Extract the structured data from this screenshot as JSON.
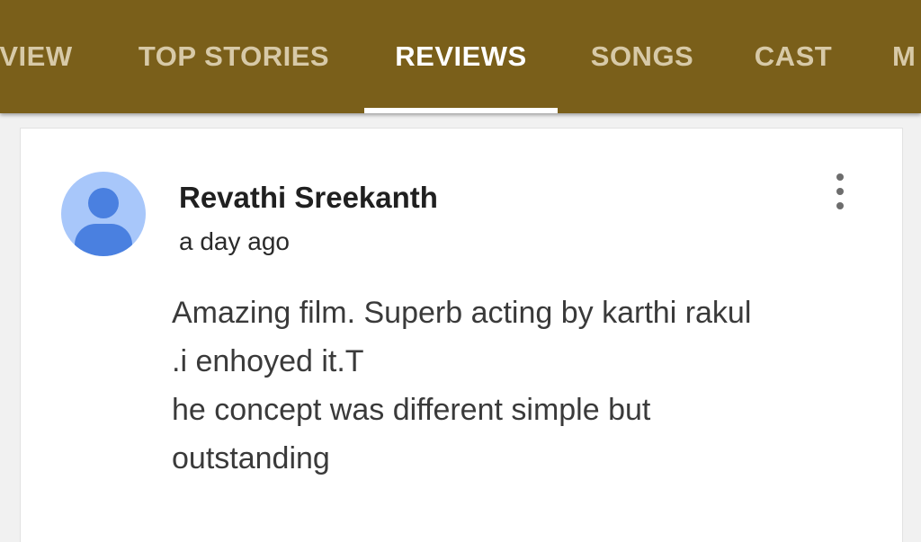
{
  "tabs": [
    {
      "label": "VIEW",
      "active": false
    },
    {
      "label": "TOP STORIES",
      "active": false
    },
    {
      "label": "REVIEWS",
      "active": true
    },
    {
      "label": "SONGS",
      "active": false
    },
    {
      "label": "CAST",
      "active": false
    },
    {
      "label": "M",
      "active": false
    }
  ],
  "colors": {
    "tabbar_bg": "#7a5f1a",
    "avatar_bg": "#a8c7fa",
    "avatar_fg": "#4a80e0"
  },
  "review": {
    "author": "Revathi Sreekanth",
    "time": "a day ago",
    "avatar_icon": "person-icon",
    "menu_icon": "more-vert-icon",
    "lines": [
      "Amazing film. Superb acting by karthi rakul",
      ".i enhoyed it.T",
      "he concept was different simple but",
      "outstanding"
    ]
  }
}
